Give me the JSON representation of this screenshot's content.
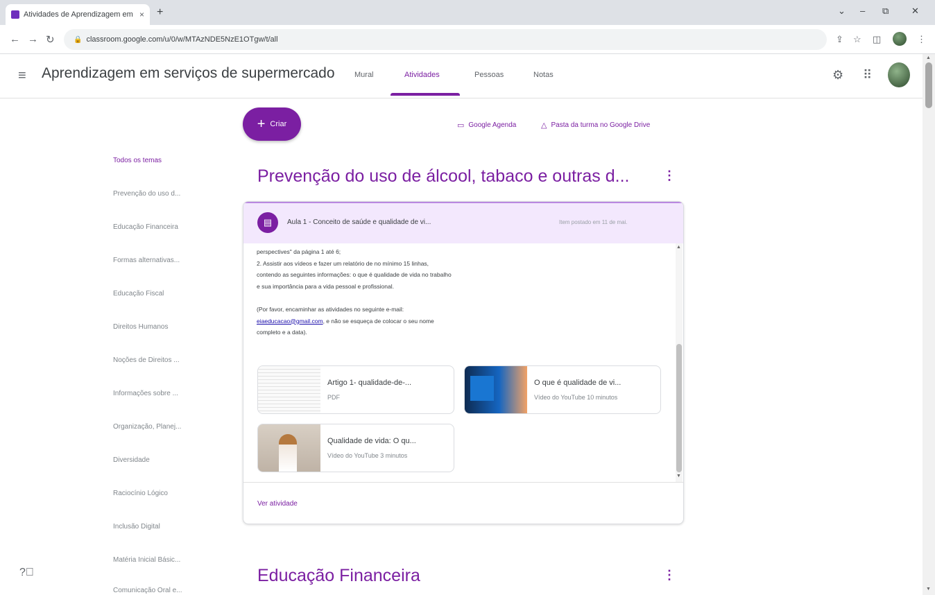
{
  "browser": {
    "tab_title": "Atividades de Aprendizagem em",
    "url": "classroom.google.com/u/0/w/MTAzNDE5NzE1OTgw/t/all",
    "min_label": "–",
    "max_label": "⧉",
    "close_label": "✕",
    "dropdown_label": "⌄",
    "new_tab_label": "+",
    "tab_close_label": "×"
  },
  "header": {
    "menu_icon": "≡",
    "course_name": "Aprendizagem em serviços de supermercado",
    "tabs": [
      {
        "label": "Mural"
      },
      {
        "label": "Atividades"
      },
      {
        "label": "Pessoas"
      },
      {
        "label": "Notas"
      }
    ],
    "active_tab": "Atividades",
    "gear_icon": "⚙",
    "apps_icon": "⠿"
  },
  "toolbar": {
    "create_plus": "+",
    "create_label": "Criar",
    "calendar_label": "Google Agenda",
    "drive_label": "Pasta da turma no Google Drive"
  },
  "topics": [
    "Todos os temas",
    "Prevenção do uso d...",
    "Educação Financeira",
    "Formas alternativas...",
    "Educação Fiscal",
    "Direitos Humanos",
    "Noções de Direitos ...",
    "Informações sobre ...",
    "Organização, Planej...",
    "Diversidade",
    "Raciocínio Lógico",
    "Inclusão Digital",
    "Matéria Inicial Básic...",
    "Comunicação Oral e..."
  ],
  "sections": [
    {
      "title": "Prevenção do uso de álcool, tabaco e outras d..."
    },
    {
      "title": "Educação Financeira"
    }
  ],
  "assignment": {
    "title": "Aula 1 - Conceito de saúde e qualidade de vi...",
    "date": "Item postado em 11 de mai.",
    "body_lines": [
      "perspectives\" da página 1 até 6;",
      "2. Assistir aos vídeos e fazer um relatório de no mínimo 15 linhas,",
      "contendo as seguintes informações: o que é qualidade de vida no trabalho",
      "e sua importância para a vida pessoal e profissional.",
      "(Por favor, encaminhar as atividades no seguinte e-mail:"
    ],
    "email": "eiaeducacao@gmail.com",
    "email_suffix": ", e não se esqueça de colocar o seu nome",
    "body_end": "completo e a data).",
    "attachments": [
      {
        "title": "Artigo 1- qualidade-de-...",
        "subtitle": "PDF"
      },
      {
        "title": "O que é qualidade de vi...",
        "subtitle": "Vídeo do YouTube   10 minutos"
      },
      {
        "title": "Qualidade de vida: O qu...",
        "subtitle": "Vídeo do YouTube   3 minutos"
      }
    ],
    "view_label": "Ver atividade"
  },
  "colors": {
    "accent": "#7b1fa2",
    "card_header": "#f3e8fd"
  }
}
